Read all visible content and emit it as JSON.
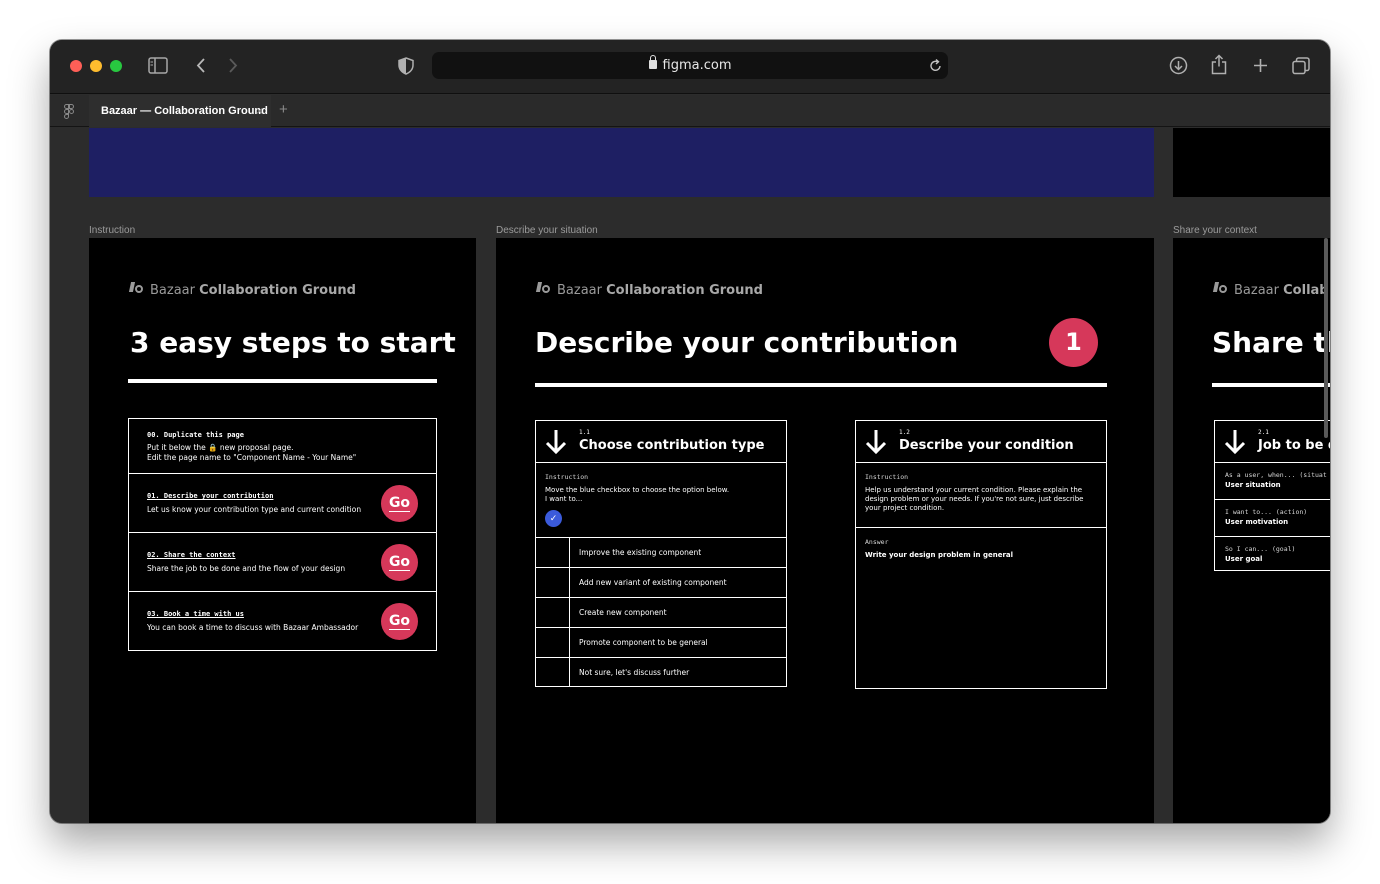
{
  "browser": {
    "url": "figma.com",
    "tab_title": "Bazaar — Collaboration Ground",
    "tab_close": "×",
    "new_tab": "+",
    "traffic_colors": {
      "close": "#ff5f57",
      "minimize": "#febc2e",
      "maximize": "#28c840"
    },
    "icons": [
      "sidebar-icon",
      "back-icon",
      "forward-icon",
      "shield-icon",
      "lock-icon",
      "reload-icon",
      "download-icon",
      "share-icon",
      "plus-icon",
      "tabs-overview-icon"
    ]
  },
  "frame_labels": {
    "instruction": "Instruction",
    "describe": "Describe your situation",
    "share": "Share your context"
  },
  "brand": {
    "name": "Bazaar",
    "sub": "Collaboration Ground",
    "sub_partial": "Collab"
  },
  "instruction": {
    "title": "3 easy steps to start",
    "steps": [
      {
        "code": "00. Duplicate this page",
        "line1": "Put it below the 🔒 new proposal page.",
        "line2": "Edit the page name to \"Component Name - Your Name\""
      },
      {
        "code": "01. Describe your contribution",
        "line1": "Let us know your contribution type and current condition",
        "button": "Go"
      },
      {
        "code": "02. Share the context",
        "line1": "Share the job to be done and the flow of your design",
        "button": "Go"
      },
      {
        "code": "03. Book a time with us",
        "line1": "You can book a time to discuss with Bazaar Ambassador",
        "button": "Go"
      }
    ]
  },
  "describe": {
    "title": "Describe your contribution",
    "badge": "1",
    "type_box": {
      "num": "1.1",
      "title": "Choose contribution type",
      "instr_label": "Instruction",
      "instr_text_1": "Move the blue checkbox to choose the option below.",
      "instr_text_2": "I want to...",
      "check_glyph": "✓",
      "options": [
        "Improve the existing component",
        "Add new variant of existing component",
        "Create new component",
        "Promote component to be general",
        "Not sure, let's discuss further"
      ]
    },
    "condition_box": {
      "num": "1.2",
      "title": "Describe your condition",
      "instr_label": "Instruction",
      "instr_text": "Help us understand your current condition. Please explain the design problem or your needs. If you're not sure, just describe your project condition.",
      "answer_label": "Answer",
      "answer_text": "Write your design problem in general"
    },
    "accent": "#d6385a",
    "check_color": "#3b5bdb"
  },
  "share": {
    "title": "Share th",
    "box": {
      "num": "2.1",
      "title": "Job to be d",
      "rows": [
        {
          "label": "As a user, when... (situat",
          "value": "User situation"
        },
        {
          "label": "I want to... (action)",
          "value": "User motivation"
        },
        {
          "label": "So I can... (goal)",
          "value": "User goal"
        }
      ]
    }
  }
}
